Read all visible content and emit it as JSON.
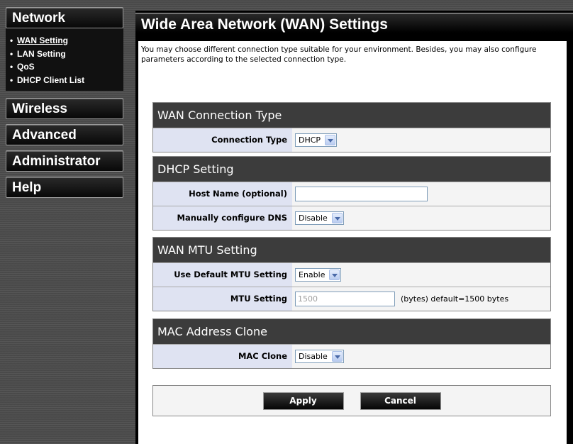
{
  "sidebar": {
    "network_label": "Network",
    "network_items": [
      "WAN Setting",
      "LAN Setting",
      "QoS",
      "DHCP Client List"
    ],
    "wireless_label": "Wireless",
    "advanced_label": "Advanced",
    "administrator_label": "Administrator",
    "help_label": "Help"
  },
  "page": {
    "title": "Wide Area Network (WAN) Settings",
    "intro": "You may choose different connection type suitable for your environment. Besides, you may also configure parameters according to the selected connection type."
  },
  "wan_connection": {
    "heading": "WAN Connection Type",
    "type_label": "Connection Type",
    "type_value": "DHCP"
  },
  "dhcp": {
    "heading": "DHCP Setting",
    "host_label": "Host Name (optional)",
    "host_value": "",
    "dns_label": "Manually configure DNS",
    "dns_value": "Disable"
  },
  "mtu": {
    "heading": "WAN MTU Setting",
    "default_label": "Use Default MTU Setting",
    "default_value": "Enable",
    "mtu_label": "MTU Setting",
    "mtu_value": "1500",
    "mtu_suffix": "(bytes) default=1500 bytes"
  },
  "mac": {
    "heading": "MAC Address Clone",
    "clone_label": "MAC Clone",
    "clone_value": "Disable"
  },
  "buttons": {
    "apply": "Apply",
    "cancel": "Cancel"
  }
}
